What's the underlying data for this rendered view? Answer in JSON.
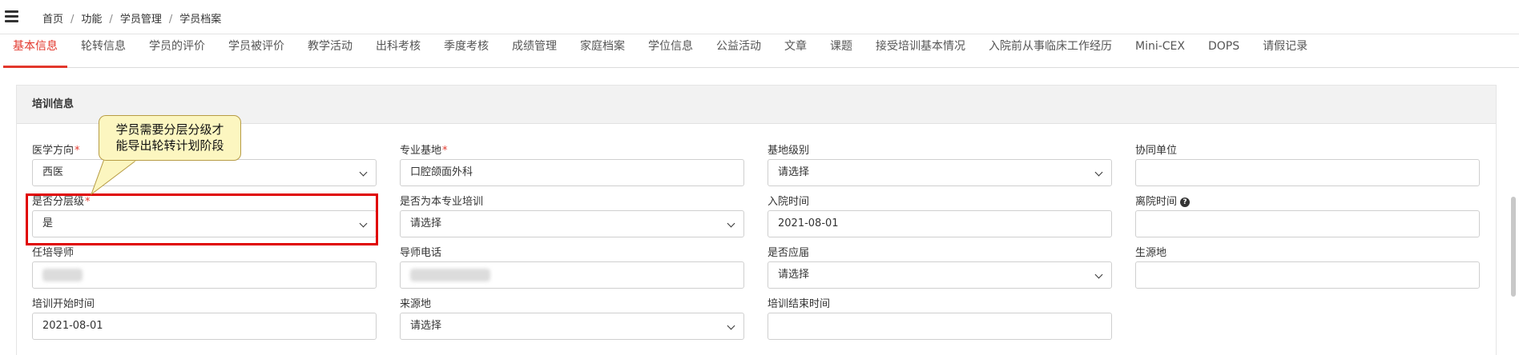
{
  "breadcrumb": [
    "首页",
    "功能",
    "学员管理",
    "学员档案"
  ],
  "tabs": [
    {
      "label": "基本信息",
      "active": true
    },
    {
      "label": "轮转信息"
    },
    {
      "label": "学员的评价"
    },
    {
      "label": "学员被评价"
    },
    {
      "label": "教学活动"
    },
    {
      "label": "出科考核"
    },
    {
      "label": "季度考核"
    },
    {
      "label": "成绩管理"
    },
    {
      "label": "家庭档案"
    },
    {
      "label": "学位信息"
    },
    {
      "label": "公益活动"
    },
    {
      "label": "文章"
    },
    {
      "label": "课题"
    },
    {
      "label": "接受培训基本情况"
    },
    {
      "label": "入院前从事临床工作经历"
    },
    {
      "label": "Mini-CEX"
    },
    {
      "label": "DOPS"
    },
    {
      "label": "请假记录"
    }
  ],
  "section": {
    "title": "培训信息"
  },
  "form": {
    "medical_direction": {
      "label": "医学方向",
      "required_mark": "*",
      "value": "西医"
    },
    "specialty_base": {
      "label": "专业基地",
      "required_mark": "*",
      "value": "口腔颌面外科"
    },
    "base_level": {
      "label": "基地级别",
      "value": "请选择"
    },
    "partner_unit": {
      "label": "协同单位",
      "value": ""
    },
    "is_tiered": {
      "label": "是否分层级",
      "required_mark": "*",
      "value": "是"
    },
    "is_own_specialty": {
      "label": "是否为本专业培训",
      "value": "请选择"
    },
    "admission_date": {
      "label": "入院时间",
      "value": "2021-08-01"
    },
    "discharge_date": {
      "label": "离院时间",
      "value": ""
    },
    "tutor": {
      "label": "任培导师",
      "value": ""
    },
    "tutor_phone": {
      "label": "导师电话",
      "value": ""
    },
    "is_fresh_grad": {
      "label": "是否应届",
      "value": "请选择"
    },
    "student_origin": {
      "label": "生源地",
      "value": ""
    },
    "training_start": {
      "label": "培训开始时间",
      "value": "2021-08-01"
    },
    "source_place": {
      "label": "来源地",
      "value": "请选择"
    },
    "training_end": {
      "label": "培训结束时间",
      "value": ""
    }
  },
  "tooltip": {
    "line1": "学员需要分层分级才",
    "line2": "能导出轮转计划阶段"
  },
  "colors": {
    "accent": "#e2372c",
    "highlight_box": "#e00000",
    "tooltip_bg": "#fcf6c0"
  }
}
